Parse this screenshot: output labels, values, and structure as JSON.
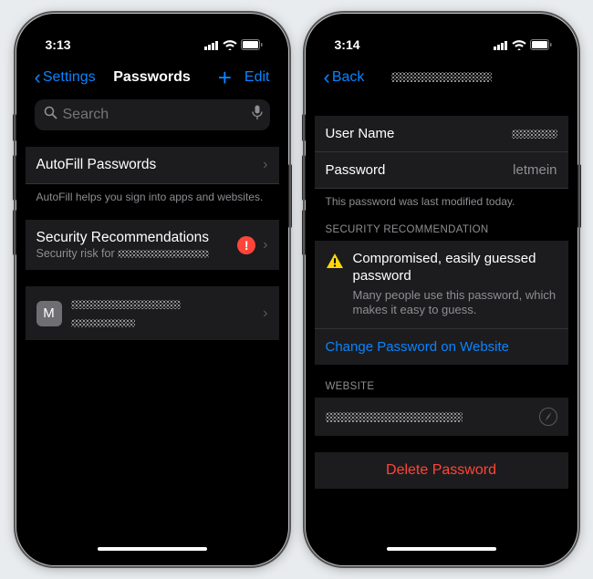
{
  "left": {
    "status_time": "3:13",
    "nav_back": "Settings",
    "nav_title": "Passwords",
    "nav_edit": "Edit",
    "search_placeholder": "Search",
    "autofill_label": "AutoFill Passwords",
    "autofill_footer": "AutoFill helps you sign into apps and websites.",
    "sec_rec_title": "Security Recommendations",
    "sec_rec_sub_prefix": "Security risk for ",
    "site_initial": "M"
  },
  "right": {
    "status_time": "3:14",
    "nav_back": "Back",
    "username_label": "User Name",
    "password_label": "Password",
    "password_value": "letmein",
    "modified_note": "This password was last modified today.",
    "sec_header": "SECURITY RECOMMENDATION",
    "rec_title": "Compromised, easily guessed password",
    "rec_sub": "Many people use this password, which makes it easy to guess.",
    "change_link": "Change Password on Website",
    "website_header": "WEBSITE",
    "delete_label": "Delete Password"
  }
}
